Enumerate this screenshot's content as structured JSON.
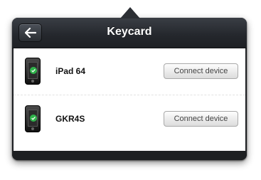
{
  "header": {
    "title": "Keycard",
    "back_icon": "arrow-left-icon"
  },
  "devices": [
    {
      "name": "iPad 64",
      "icon": "phone-check-icon",
      "button_label": "Connect device"
    },
    {
      "name": "GKR4S",
      "icon": "phone-check-icon",
      "button_label": "Connect device"
    }
  ],
  "colors": {
    "header_bg": "#24272c",
    "status_ok": "#2fb24a"
  }
}
